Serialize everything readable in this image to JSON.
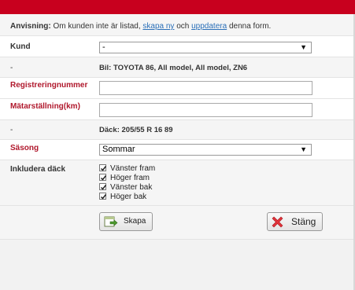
{
  "notice": {
    "label": "Anvisning:",
    "text1": "Om kunden inte är listad,",
    "link_create": "skapa ny",
    "text2": "och",
    "link_update": "uppdatera",
    "text3": "denna form."
  },
  "form": {
    "customer": {
      "label": "Kund",
      "value": "-"
    },
    "car": {
      "label": "-",
      "value": "Bil: TOYOTA 86, All model, All model, ZN6"
    },
    "registration": {
      "label": "Registreringnummer",
      "value": ""
    },
    "odometer": {
      "label": "Mätarställning(km)",
      "value": ""
    },
    "tire": {
      "label": "-",
      "value": "Däck: 205/55 R 16 89"
    },
    "season": {
      "label": "Säsong",
      "value": "Sommar"
    },
    "include_tires": {
      "label": "Inkludera däck",
      "options": [
        {
          "label": "Vänster fram",
          "checked": true
        },
        {
          "label": "Höger fram",
          "checked": true
        },
        {
          "label": "Vänster bak",
          "checked": true
        },
        {
          "label": "Höger bak",
          "checked": true
        }
      ]
    }
  },
  "buttons": {
    "create": "Skapa",
    "close": "Stäng"
  },
  "colors": {
    "brand": "#c8001e",
    "required_label": "#b0182c",
    "link": "#2a6fb8"
  },
  "icons": {
    "create": "create-document-icon",
    "close": "close-x-icon",
    "dropdown": "chevron-down-icon",
    "checkbox": "checkmark-icon"
  }
}
